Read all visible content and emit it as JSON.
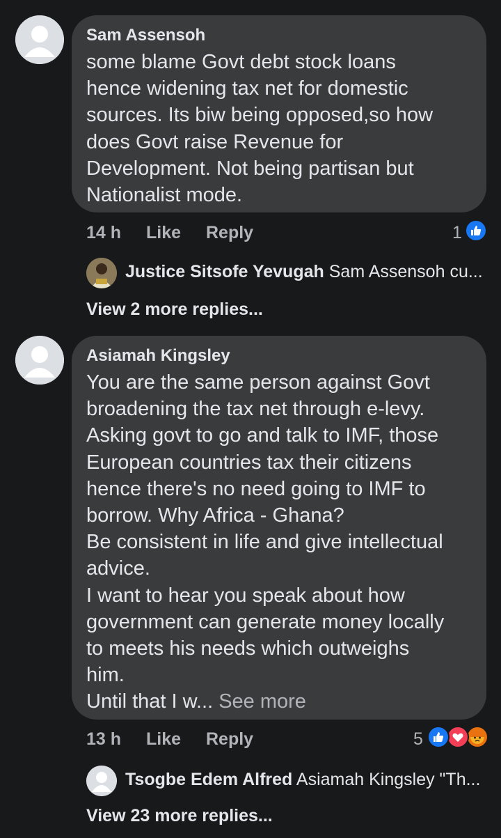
{
  "comments": [
    {
      "author": "Sam Assensoh",
      "text": "some blame Govt debt stock loans\nhence widening tax net for domestic\nsources. Its biw being opposed,so how\ndoes Govt raise Revenue for\nDevelopment. Not being partisan but\nNationalist mode.",
      "time": "14 h",
      "like_label": "Like",
      "reply_label": "Reply",
      "reaction_count": "1",
      "reactions": [
        "like-icon"
      ],
      "preview_reply": {
        "author": "Justice Sitsofe Yevugah",
        "snippet": "Sam Assensoh cu..."
      },
      "view_more": "View 2 more replies..."
    },
    {
      "author": "Asiamah Kingsley",
      "text": "You are the same person against Govt\nbroadening the tax net through e-levy.\nAsking govt to go and talk to IMF, those\nEuropean countries tax their citizens\nhence there's no need going to IMF to\nborrow. Why Africa - Ghana?\nBe consistent in life and give intellectual\nadvice.\nI want to hear you speak about how\ngovernment can generate money locally\nto meets his needs which outweighs\nhim.\nUntil that I w...",
      "see_more": "See more",
      "time": "13 h",
      "like_label": "Like",
      "reply_label": "Reply",
      "reaction_count": "5",
      "reactions": [
        "like-icon",
        "love-icon",
        "angry-icon"
      ],
      "preview_reply": {
        "author": "Tsogbe Edem Alfred",
        "snippet": "Asiamah Kingsley \"Th..."
      },
      "view_more": "View 23 more replies..."
    }
  ],
  "colors": {
    "background": "#18191a",
    "bubble": "#3a3b3c",
    "primary_text": "#e4e6eb",
    "secondary_text": "#b0b3b8",
    "like_blue": "#1877f2",
    "love_red": "#f33e58",
    "angry_orange": "#f7b125"
  }
}
